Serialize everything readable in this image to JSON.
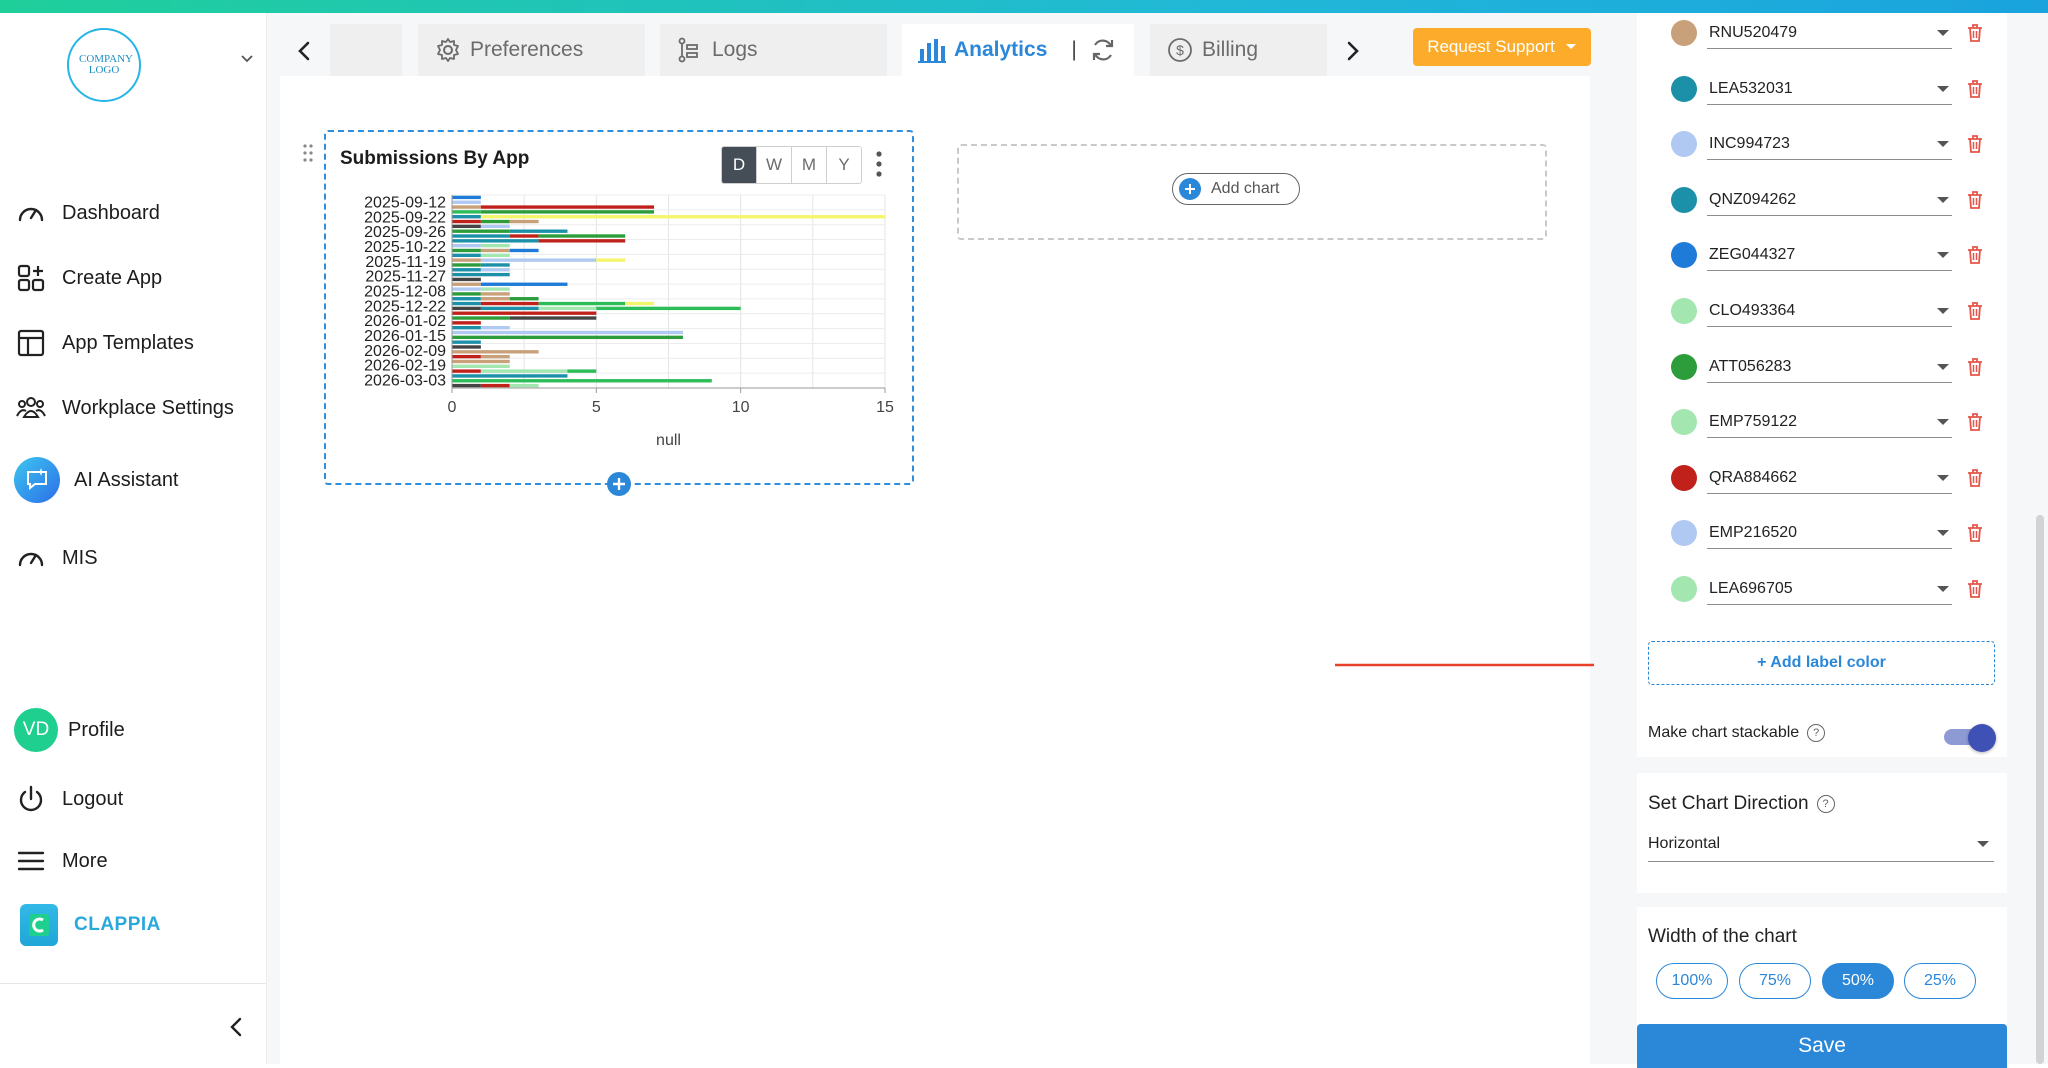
{
  "logo": {
    "text": "COMPANY LOGO"
  },
  "sidebar": {
    "items": [
      {
        "label": "Dashboard",
        "icon": "gauge-icon"
      },
      {
        "label": "Create App",
        "icon": "create-app-icon"
      },
      {
        "label": "App Templates",
        "icon": "template-icon"
      },
      {
        "label": "Workplace Settings",
        "icon": "team-icon"
      },
      {
        "label": "AI Assistant",
        "icon": "ai-chat-icon"
      },
      {
        "label": "MIS",
        "icon": "gauge-icon"
      }
    ],
    "profile": {
      "initials": "VD",
      "label": "Profile"
    },
    "logout": "Logout",
    "more": "More",
    "brand": "CLAPPIA"
  },
  "tabs": {
    "items": [
      {
        "label": "",
        "icon": ""
      },
      {
        "label": "Preferences",
        "icon": "gear-icon"
      },
      {
        "label": "Logs",
        "icon": "logs-icon"
      },
      {
        "label": "Analytics",
        "icon": "bar-chart-icon",
        "active": true
      },
      {
        "label": "Billing",
        "icon": "dollar-icon"
      }
    ],
    "request_support": "Request Support"
  },
  "chart_card": {
    "title": "Submissions By App",
    "periods": [
      "D",
      "W",
      "M",
      "Y"
    ],
    "active_period": "D"
  },
  "add_chart": "Add chart",
  "chart_data": {
    "type": "bar",
    "orientation": "horizontal",
    "stacked": true,
    "title": "Submissions By App",
    "xlabel": "null",
    "xlim": [
      0,
      15
    ],
    "xticks": [
      0,
      5,
      10,
      15
    ],
    "categories": [
      "2025-09-12",
      "2025-09-22",
      "2025-09-26",
      "2025-10-22",
      "2025-11-19",
      "2025-11-27",
      "2025-12-08",
      "2025-12-22",
      "2026-01-02",
      "2026-01-15",
      "2026-02-09",
      "2026-02-19",
      "2026-03-03"
    ],
    "rows": [
      [
        [
          "#1f7bd8",
          1
        ]
      ],
      [
        [
          "#b0c9f2",
          1
        ]
      ],
      [
        [
          "#c8a079",
          1
        ],
        [
          "#c0221b",
          6
        ]
      ],
      [
        [
          "#2dbd58",
          1
        ],
        [
          "#2d9c3b",
          6
        ]
      ],
      [
        [
          "#1b90a8",
          1
        ],
        [
          "#f5f56c",
          14
        ]
      ],
      [
        [
          "#c0221b",
          1
        ],
        [
          "#2d9c3b",
          1
        ],
        [
          "#c8a079",
          1
        ]
      ],
      [
        [
          "#444444",
          1
        ],
        [
          "#b0c9f2",
          1
        ]
      ],
      [
        [
          "#2d9c3b",
          2
        ],
        [
          "#1b90a8",
          2
        ]
      ],
      [
        [
          "#1b90a8",
          2
        ],
        [
          "#c0221b",
          1
        ],
        [
          "#2d9c3b",
          3
        ]
      ],
      [
        [
          "#1b90a8",
          3
        ],
        [
          "#c0221b",
          3
        ]
      ],
      [
        [
          "#b0c9f2",
          1
        ],
        [
          "#a3e6b0",
          1
        ]
      ],
      [
        [
          "#2d9c3b",
          1
        ],
        [
          "#c8a079",
          1
        ],
        [
          "#1f7bd8",
          1
        ]
      ],
      [
        [
          "#1b90a8",
          1
        ],
        [
          "#a3e6b0",
          1
        ]
      ],
      [
        [
          "#c8a079",
          1
        ],
        [
          "#b0c9f2",
          4
        ],
        [
          "#f5f56c",
          1
        ]
      ],
      [
        [
          "#2d9c3b",
          1
        ],
        [
          "#1b90a8",
          1
        ]
      ],
      [
        [
          "#1b90a8",
          1
        ],
        [
          "#b0c9f2",
          1
        ]
      ],
      [
        [
          "#1b90a8",
          2
        ]
      ],
      [
        [
          "#444444",
          1
        ]
      ],
      [
        [
          "#c8a079",
          1
        ],
        [
          "#1f7bd8",
          3
        ]
      ],
      [
        [
          "#b0c9f2",
          1
        ],
        [
          "#a3e6b0",
          1
        ]
      ],
      [
        [
          "#2d9c3b",
          1
        ],
        [
          "#c8a079",
          1
        ]
      ],
      [
        [
          "#1b90a8",
          1
        ],
        [
          "#c8a079",
          1
        ],
        [
          "#2d9c3b",
          1
        ]
      ],
      [
        [
          "#1b90a8",
          1
        ],
        [
          "#c0221b",
          2
        ],
        [
          "#2dbd58",
          3
        ],
        [
          "#f5f56c",
          1
        ]
      ],
      [
        [
          "#444444",
          1
        ],
        [
          "#1b90a8",
          2
        ],
        [
          "#a3e6b0",
          2
        ],
        [
          "#2dbd58",
          5
        ]
      ],
      [
        [
          "#c0221b",
          5
        ]
      ],
      [
        [
          "#2d9c3b",
          2
        ],
        [
          "#444444",
          3
        ]
      ],
      [
        [
          "#c0221b",
          1
        ]
      ],
      [
        [
          "#1b90a8",
          1
        ],
        [
          "#b0c9f2",
          1
        ]
      ],
      [
        [
          "#b0c9f2",
          8
        ]
      ],
      [
        [
          "#2d9c3b",
          8
        ]
      ],
      [
        [
          "#1b90a8",
          1
        ]
      ],
      [
        [
          "#444444",
          1
        ]
      ],
      [
        [
          "#c8a079",
          3
        ]
      ],
      [
        [
          "#c0221b",
          1
        ],
        [
          "#c8a079",
          1
        ]
      ],
      [
        [
          "#c8a079",
          2
        ]
      ],
      [
        [
          "#a3e6b0",
          2
        ]
      ],
      [
        [
          "#c0221b",
          1
        ],
        [
          "#a3e6b0",
          3
        ],
        [
          "#2dbd58",
          1
        ]
      ],
      [
        [
          "#1b90a8",
          4
        ]
      ],
      [
        [
          "#2dbd58",
          9
        ]
      ],
      [
        [
          "#444444",
          1
        ],
        [
          "#c0221b",
          1
        ],
        [
          "#a3e6b0",
          1
        ]
      ]
    ]
  },
  "panel": {
    "labels": [
      {
        "name": "RNU520479",
        "color": "#c8a079"
      },
      {
        "name": "LEA532031",
        "color": "#1b90a8"
      },
      {
        "name": "INC994723",
        "color": "#b0c9f2"
      },
      {
        "name": "QNZ094262",
        "color": "#1b90a8"
      },
      {
        "name": "ZEG044327",
        "color": "#1f7bd8"
      },
      {
        "name": "CLO493364",
        "color": "#a3e6b0"
      },
      {
        "name": "ATT056283",
        "color": "#2d9c3b"
      },
      {
        "name": "EMP759122",
        "color": "#a3e6b0"
      },
      {
        "name": "QRA884662",
        "color": "#c0221b"
      },
      {
        "name": "EMP216520",
        "color": "#b0c9f2"
      },
      {
        "name": "LEA696705",
        "color": "#a3e6b0"
      }
    ],
    "add_label_color": "+ Add label color",
    "stackable": {
      "label": "Make chart stackable",
      "help": "?",
      "on": true
    },
    "direction": {
      "label": "Set Chart Direction",
      "help": "?",
      "value": "Horizontal"
    },
    "width": {
      "label": "Width of the chart",
      "options": [
        "100%",
        "75%",
        "50%",
        "25%"
      ],
      "selected": "50%"
    },
    "save": "Save"
  },
  "colors": {
    "accent": "#2b87d8",
    "support": "#fcac2a",
    "arrow": "#e8402a"
  }
}
